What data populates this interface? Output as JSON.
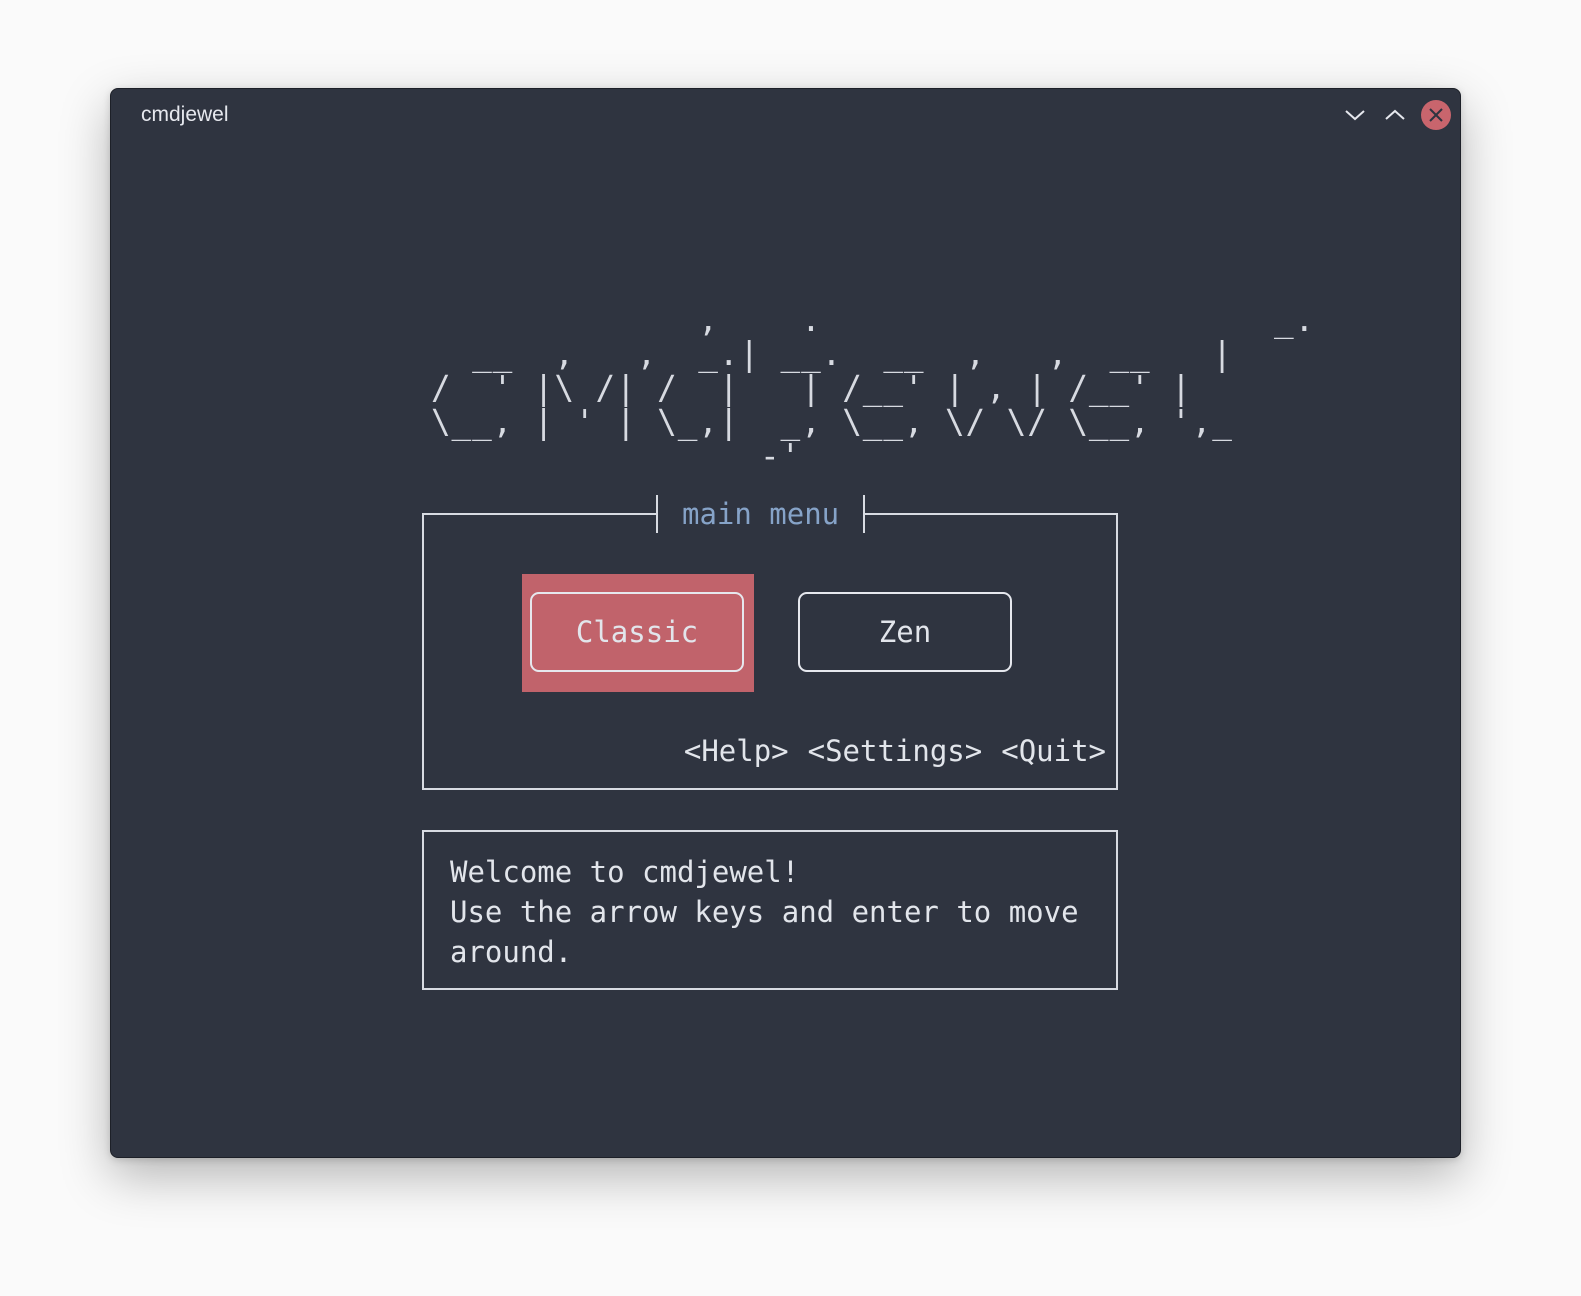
{
  "window": {
    "title": "cmdjewel",
    "controls": {
      "minimize_icon": "chevron-down-icon",
      "maximize_icon": "chevron-up-icon",
      "close_icon": "close-icon"
    }
  },
  "logo": {
    "ascii": "             ,    .                      _.\n  __  ,   ,  _.| __.  __  ,   ,  __   |\n/  ' |\\ /| /  |   | /__' | , | /__' |\n\\__, | ' | \\_,|  _, \\__, \\/ \\/ \\__, ',_\n                -'"
  },
  "menu": {
    "title": "main menu",
    "buttons": {
      "classic": "Classic",
      "zen": "Zen"
    },
    "links": {
      "help": "<Help>",
      "settings": "<Settings>",
      "quit": "<Quit>"
    }
  },
  "message": {
    "line1": "Welcome to cmdjewel!",
    "line2": "Use the arrow keys and enter to move",
    "line3": "around."
  },
  "colors": {
    "background": "#2f3440",
    "accent": "#c1636b",
    "title_blue": "#86a3c8",
    "text": "#e2e5eb"
  }
}
